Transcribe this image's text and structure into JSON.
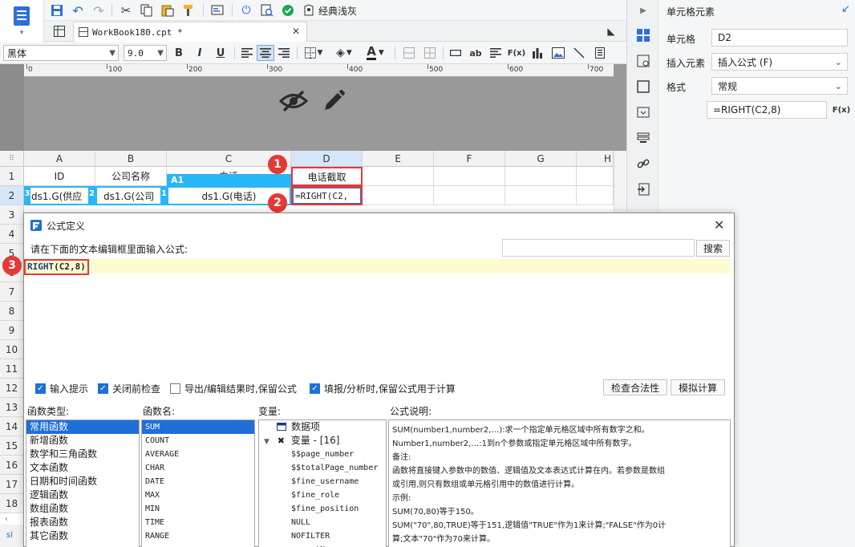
{
  "toolbar": {
    "theme_label": "经典浅灰"
  },
  "tab": {
    "title": "WorkBook180.cpt *",
    "close": "✕"
  },
  "format_bar": {
    "font": "黑体",
    "size": "9.0",
    "bold": "B",
    "italic": "I",
    "underline": "U",
    "text_label": "ab",
    "fx": "F(x)"
  },
  "ruler": {
    "ticks": [
      "0",
      "100",
      "200",
      "300",
      "400",
      "500",
      "600",
      "700"
    ]
  },
  "grid": {
    "columns": [
      "A",
      "B",
      "C",
      "D",
      "E",
      "F",
      "G",
      "H"
    ],
    "rows": [
      "1",
      "2",
      "3",
      "4",
      "5",
      "6",
      "7",
      "8",
      "9",
      "10",
      "11",
      "12",
      "13",
      "14",
      "15",
      "16",
      "17",
      "18"
    ],
    "header_cells": {
      "a1": "ID",
      "b1": "公司名称",
      "c1": "电话",
      "d1": "电话截取"
    },
    "data_cells": {
      "a2": "ds1.G(供应",
      "b2": "ds1.G(公司",
      "c2": "ds1.G(电话)",
      "d2": "=RIGHT(C2,"
    },
    "markers": {
      "a2": "3",
      "b2": "2",
      "c2": "1",
      "selection": "A1"
    }
  },
  "steps": [
    "1",
    "2",
    "3"
  ],
  "right_panel": {
    "title": "单元格元素",
    "cell_label": "单元格",
    "cell_value": "D2",
    "insert_label": "插入元素",
    "insert_value": "插入公式 (F)",
    "format_label": "格式",
    "format_value": "常规",
    "formula_value": "=RIGHT(C2,8)",
    "fx": "F(x)"
  },
  "dialog": {
    "title": "公式定义",
    "prompt": "请在下面的文本编辑框里面输入公式:",
    "search_button": "搜索",
    "formula_fn": "RIGHT",
    "formula_args": "(C2,8)",
    "checkboxes": [
      {
        "label": "输入提示",
        "checked": true
      },
      {
        "label": "关闭前检查",
        "checked": true
      },
      {
        "label": "导出/编辑结果时,保留公式",
        "checked": false
      },
      {
        "label": "填报/分析时,保留公式用于计算",
        "checked": true
      }
    ],
    "check_button": "检查合法性",
    "simulate_button": "模拟计算",
    "fn_type_header": "函数类型:",
    "fn_name_header": "函数名:",
    "var_header": "变量:",
    "desc_header": "公式说明:",
    "fn_types": [
      "常用函数",
      "新增函数",
      "数学和三角函数",
      "文本函数",
      "日期和时间函数",
      "逻辑函数",
      "数组函数",
      "报表函数",
      "其它函数"
    ],
    "fn_names": [
      "SUM",
      "COUNT",
      "AVERAGE",
      "CHAR",
      "DATE",
      "MAX",
      "MIN",
      "TIME",
      "RANGE"
    ],
    "var_root1": "数据项",
    "var_root2": "变量 - [16]",
    "variables": [
      "$$page_number",
      "$$totalPage_number",
      "$fine_username",
      "$fine_role",
      "$fine_position",
      "NULL",
      "NOFILTER",
      "reportName"
    ],
    "description": [
      "SUM(number1,number2,…):求一个指定单元格区域中所有数字之和。",
      "Number1,number2,…:1到n个参数或指定单元格区域中所有数字。",
      "备注:",
      "函数将直接键入参数中的数值、逻辑值及文本表达式计算在内。若参数是数组",
      "或引用,则只有数组或单元格引用中的数值进行计算。",
      "示例:",
      "SUM(70,80)等于150。",
      "SUM(\"70\",80,TRUE)等于151,逻辑值\"TRUE\"作为1来计算;\"FALSE\"作为0计",
      "算;文本\"70\"作为70来计算。"
    ]
  },
  "bottom": {
    "label": "sl"
  },
  "colors": {
    "accent": "#1e6fd9",
    "marker": "#e53935",
    "cell_blue": "#29b6f6",
    "formula_bar": "#fffbd0"
  }
}
